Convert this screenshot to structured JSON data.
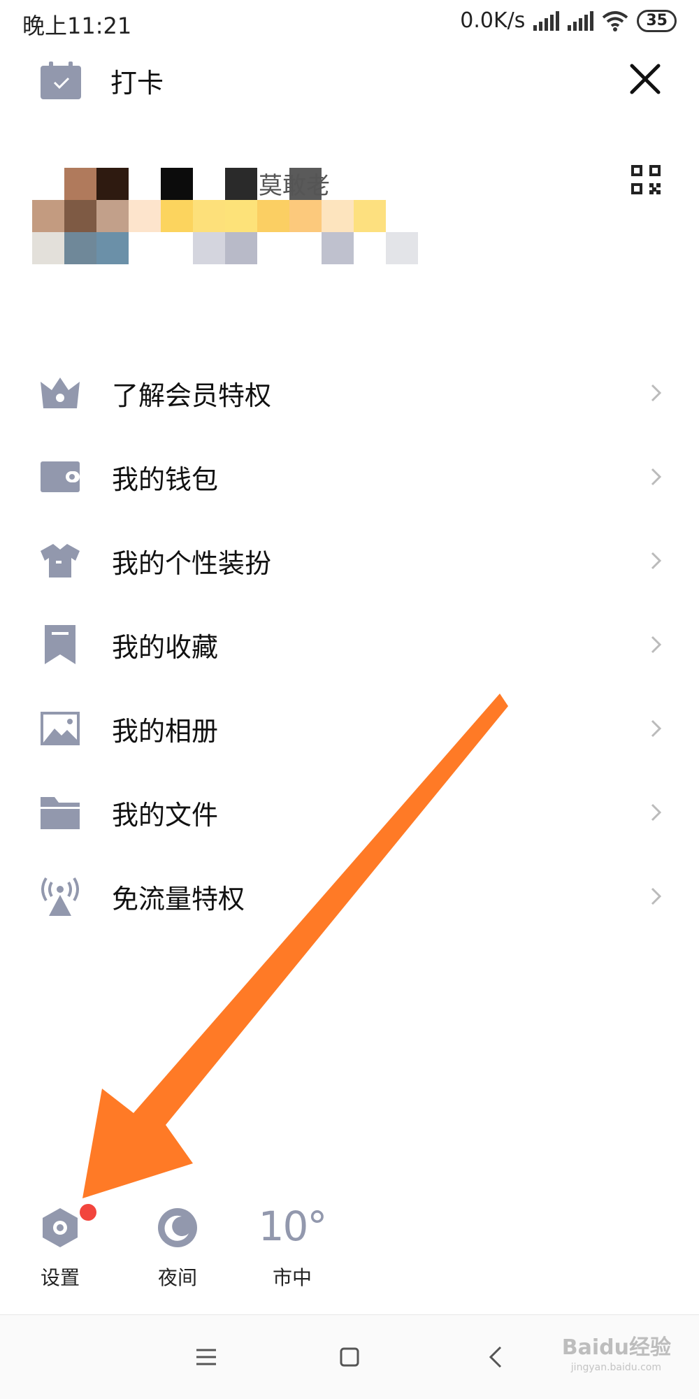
{
  "status_bar": {
    "time": "晚上11:21",
    "net_speed": "0.0K/s",
    "battery": "35"
  },
  "header": {
    "checkin_label": "打卡"
  },
  "profile": {
    "name_fragment": "莫敢老"
  },
  "menu": [
    {
      "label": "了解会员特权",
      "icon": "crown-icon"
    },
    {
      "label": "我的钱包",
      "icon": "wallet-icon"
    },
    {
      "label": "我的个性装扮",
      "icon": "shirt-icon"
    },
    {
      "label": "我的收藏",
      "icon": "bookmark-icon"
    },
    {
      "label": "我的相册",
      "icon": "photo-icon"
    },
    {
      "label": "我的文件",
      "icon": "folder-icon"
    },
    {
      "label": "免流量特权",
      "icon": "signal-tower-icon"
    }
  ],
  "bottom": {
    "settings_label": "设置",
    "night_label": "夜间",
    "weather_temp": "10°",
    "weather_city": "市中"
  },
  "watermark": {
    "brand": "Baidu经验",
    "url": "jingyan.baidu.com"
  },
  "colors": {
    "icon_gray": "#9298ad",
    "arrow_orange": "#ff7a26",
    "badge_red": "#f2453d"
  }
}
